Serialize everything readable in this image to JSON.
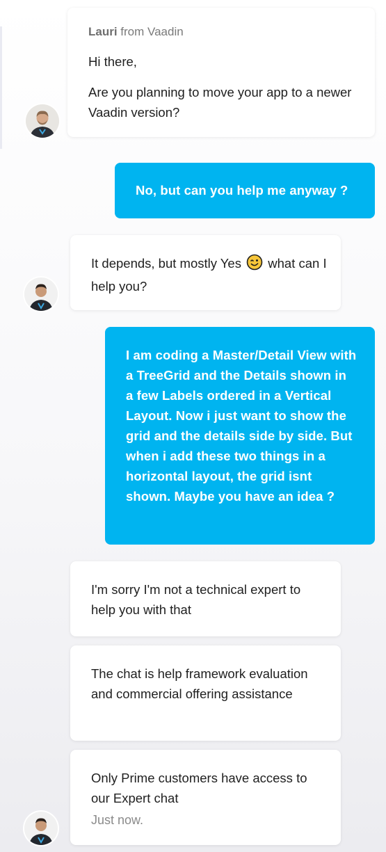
{
  "conversation": {
    "intro": {
      "sender_name": "Lauri",
      "sender_suffix": "from Vaadin",
      "greeting": "Hi there,",
      "question": "Are you planning to move your app to a newer Vaadin version?"
    },
    "user_msg_1": "No, but can you help me anyway ?",
    "agent_msg_1": {
      "text_before": "It depends, but mostly Yes",
      "emoji": "winking-face",
      "text_after": "what can I help you?"
    },
    "user_msg_2": "I am coding a Master/Detail View with a TreeGrid and the Details shown in a few Labels ordered in a Vertical Layout. Now i just want to show the grid and the details side by side. But when i add these two things in a horizontal layout, the grid isnt shown. Maybe you have an idea ?",
    "agent_msg_2": "I'm sorry I'm not a technical expert to help you with that",
    "agent_msg_3": "The chat is help framework evaluation and commercial offering assistance",
    "agent_msg_4": "Only Prime customers have access to our Expert chat",
    "timestamp": "Just now."
  },
  "colors": {
    "user_bubble": "#00b4f0",
    "agent_bubble": "#ffffff",
    "emoji": "#f7c63a"
  }
}
